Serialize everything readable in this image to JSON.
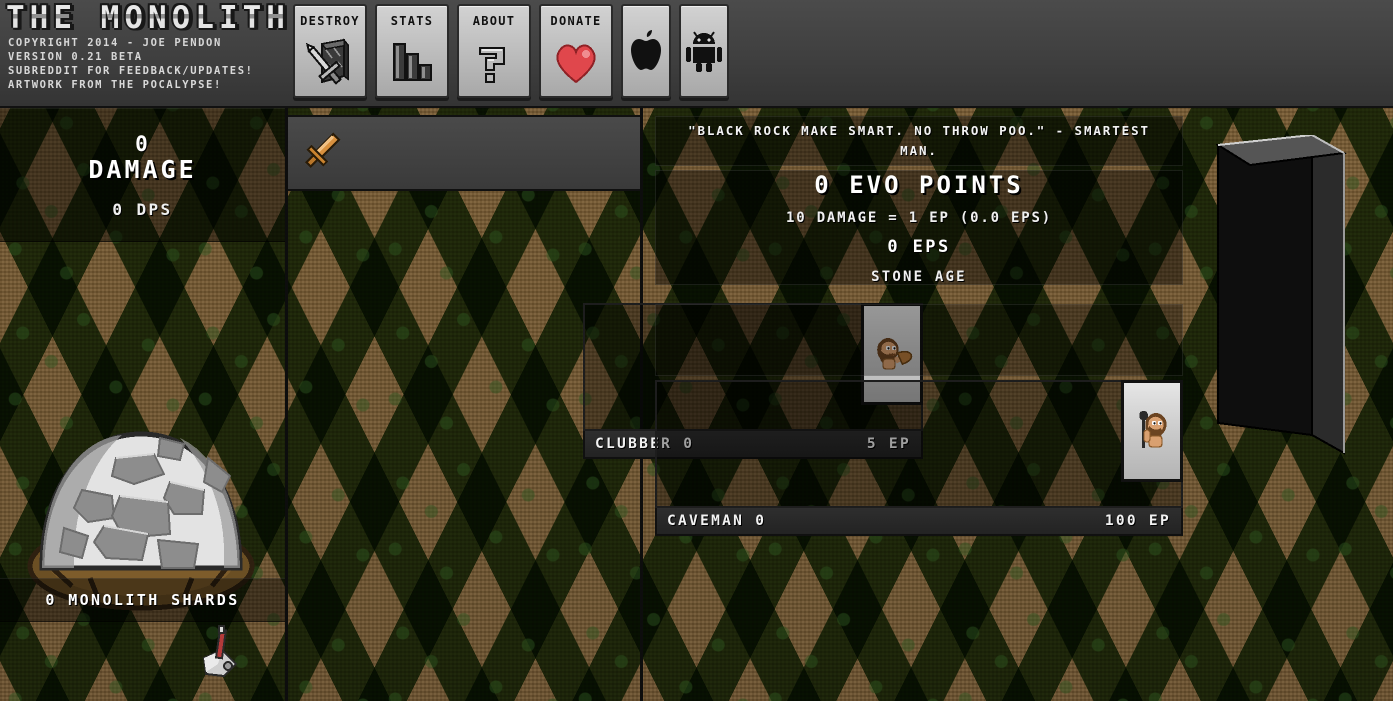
{
  "header": {
    "game_title": "THE MONOLITH",
    "credits": [
      {
        "text": "COPYRIGHT 2014 - JOE PENDON",
        "link": false
      },
      {
        "text": "VERSION 0.21 BETA",
        "link": false
      },
      {
        "text": "SUBREDDIT FOR FEEDBACK/UPDATES!",
        "link": true
      },
      {
        "text": "ARTWORK FROM THE POCALYPSE!",
        "link": true
      }
    ],
    "buttons": [
      {
        "label": "DESTROY",
        "icon": "monolith-sword-icon"
      },
      {
        "label": "STATS",
        "icon": "bar-chart-icon"
      },
      {
        "label": "ABOUT",
        "icon": "question-mark-icon"
      },
      {
        "label": "DONATE",
        "icon": "heart-icon"
      },
      {
        "label": "",
        "icon": "apple-icon"
      },
      {
        "label": "",
        "icon": "android-icon"
      }
    ]
  },
  "left": {
    "damage_value": "0",
    "damage_label": "DAMAGE",
    "dps": "0 DPS",
    "shards": "0 MONOLITH SHARDS",
    "rock_icon": "monolith-shard-rock-icon",
    "pickaxe_icon": "pickaxe-icon"
  },
  "middle": {
    "weapon_slot_icon": "sword-icon",
    "units": [
      {
        "name": "CLUBBER 0",
        "cost": "5 EP",
        "portrait": "clubber-sprite"
      }
    ]
  },
  "right": {
    "quote": "\"BLACK ROCK MAKE SMART. NO THROW POO.\" - SMARTEST MAN.",
    "evo_points": "0 EVO POINTS",
    "conversion": "10 DAMAGE = 1 EP (0.0 EPS)",
    "eps": "0 EPS",
    "age": "STONE AGE",
    "units": [
      {
        "name": "CAVEMAN 0",
        "cost": "100 EP",
        "portrait": "caveman-sprite"
      }
    ],
    "monolith_icon": "monolith-slab-icon"
  },
  "colors": {
    "header_bg": "#3f3f3f",
    "button_face": "#c4c4c4",
    "text_light": "#f2f2f2",
    "ground_dirt": "#7a5c33",
    "ground_grass": "#3c6828",
    "monolith_face": "#0e0e0e",
    "monolith_top": "#4a4a4a",
    "heart_red": "#e0474c",
    "sword_gold": "#d9913f"
  }
}
